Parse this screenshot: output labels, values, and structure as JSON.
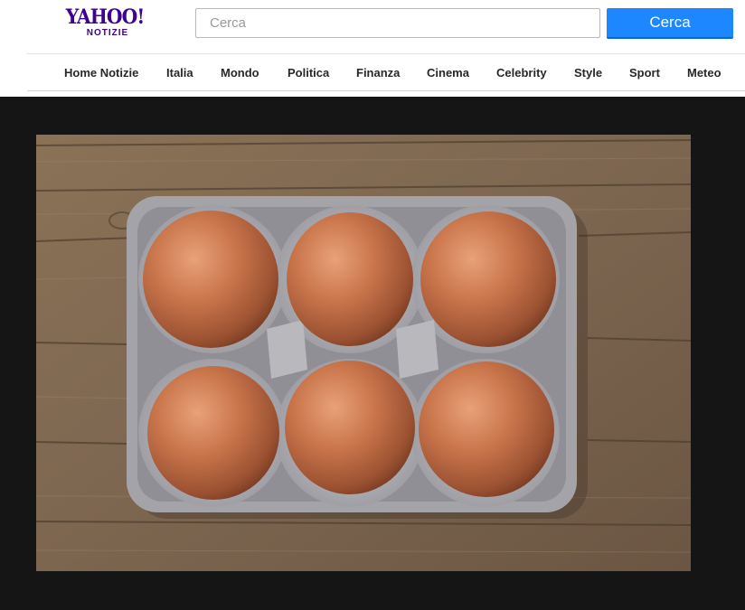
{
  "header": {
    "logo": {
      "main": "YAHOO!",
      "sub": "NOTIZIE",
      "color": "#400090"
    },
    "search": {
      "placeholder": "Cerca",
      "value": "",
      "button_label": "Cerca",
      "button_color": "#1d87ff"
    }
  },
  "nav": {
    "items": [
      {
        "label": "Home Notizie"
      },
      {
        "label": "Italia"
      },
      {
        "label": "Mondo"
      },
      {
        "label": "Politica"
      },
      {
        "label": "Finanza"
      },
      {
        "label": "Cinema"
      },
      {
        "label": "Celebrity"
      },
      {
        "label": "Style"
      },
      {
        "label": "Sport"
      },
      {
        "label": "Meteo"
      }
    ]
  },
  "article": {
    "background_color": "#151515",
    "image": {
      "subject": "six brown eggs in a grey cardboard egg carton on a wooden table"
    }
  }
}
